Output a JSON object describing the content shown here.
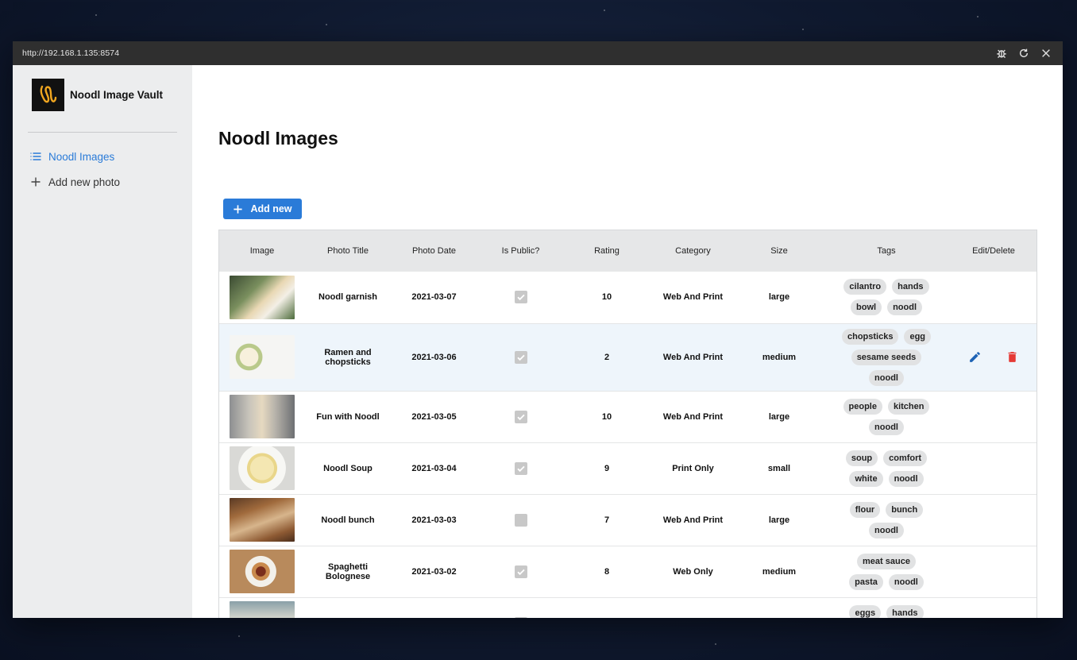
{
  "browser": {
    "url": "http://192.168.1.135:8574"
  },
  "sidebar": {
    "app_name": "Noodl Image Vault",
    "items": [
      {
        "label": "Noodl Images",
        "icon": "list-icon",
        "active": true
      },
      {
        "label": "Add new photo",
        "icon": "plus-icon",
        "active": false
      }
    ]
  },
  "main": {
    "title": "Noodl Images",
    "add_button": "Add new"
  },
  "table": {
    "headers": [
      "Image",
      "Photo Title",
      "Photo Date",
      "Is Public?",
      "Rating",
      "Category",
      "Size",
      "Tags",
      "Edit/Delete"
    ],
    "rows": [
      {
        "title": "Noodl garnish",
        "date": "2021-03-07",
        "public": true,
        "rating": "10",
        "category": "Web And Print",
        "size": "large",
        "tags": [
          "cilantro",
          "hands",
          "bowl",
          "noodl"
        ],
        "image": "bowl-garnish"
      },
      {
        "title": "Ramen and chopsticks",
        "date": "2021-03-06",
        "public": true,
        "rating": "2",
        "category": "Web And Print",
        "size": "medium",
        "tags": [
          "chopsticks",
          "egg",
          "sesame seeds",
          "noodl"
        ],
        "image": "ramen-bowls",
        "hovered": true
      },
      {
        "title": "Fun with Noodl",
        "date": "2021-03-05",
        "public": true,
        "rating": "10",
        "category": "Web And Print",
        "size": "large",
        "tags": [
          "people",
          "kitchen",
          "noodl"
        ],
        "image": "kitchen-people"
      },
      {
        "title": "Noodl Soup",
        "date": "2021-03-04",
        "public": true,
        "rating": "9",
        "category": "Print Only",
        "size": "small",
        "tags": [
          "soup",
          "comfort",
          "white",
          "noodl"
        ],
        "image": "noodle-soup"
      },
      {
        "title": "Noodl bunch",
        "date": "2021-03-03",
        "public": false,
        "rating": "7",
        "category": "Web And Print",
        "size": "large",
        "tags": [
          "flour",
          "bunch",
          "noodl"
        ],
        "image": "noodle-bunch"
      },
      {
        "title": "Spaghetti Bolognese",
        "date": "2021-03-02",
        "public": true,
        "rating": "8",
        "category": "Web Only",
        "size": "medium",
        "tags": [
          "meat sauce",
          "pasta",
          "noodl"
        ],
        "image": "spaghetti-plate"
      },
      {
        "title": "",
        "date": "",
        "public": true,
        "rating": "",
        "category": "",
        "size": "",
        "tags": [
          "eggs",
          "hands"
        ],
        "image": "bowl-partial"
      }
    ]
  },
  "colors": {
    "accent": "#2a7bd8",
    "delete": "#e53935",
    "edit": "#1e63b5"
  }
}
